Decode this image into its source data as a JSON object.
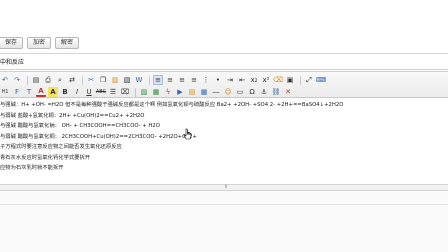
{
  "buttons": {
    "save_label": "保存",
    "encrypt_label": "加密",
    "decrypt_label": "解密"
  },
  "note": {
    "title": "中和反应"
  },
  "toolbar": {
    "row1": [
      {
        "name": "undo-icon",
        "glyph": "↶",
        "color": "blue"
      },
      {
        "name": "redo-icon",
        "glyph": "↷",
        "color": "blue"
      },
      {
        "name": "sep"
      },
      {
        "name": "preview-icon",
        "glyph": "▤"
      },
      {
        "name": "print-icon",
        "glyph": "⎙"
      },
      {
        "name": "search-icon",
        "glyph": "⌕"
      },
      {
        "name": "replace-icon",
        "glyph": "⇄"
      },
      {
        "name": "sep"
      },
      {
        "name": "cut-icon",
        "glyph": "✂",
        "color": "blue"
      },
      {
        "name": "copy-icon",
        "glyph": "❐"
      },
      {
        "name": "paste-icon",
        "glyph": "▥",
        "color": "orange"
      },
      {
        "name": "paste-text-icon",
        "glyph": "▧"
      },
      {
        "name": "paste-word-icon",
        "glyph": "W",
        "color": "blue"
      },
      {
        "name": "sep"
      },
      {
        "name": "align-left-icon",
        "glyph": "≡",
        "active": true
      },
      {
        "name": "align-center-icon",
        "glyph": "≡"
      },
      {
        "name": "align-right-icon",
        "glyph": "≡"
      },
      {
        "name": "align-justify-icon",
        "glyph": "≡"
      },
      {
        "name": "ordered-list-icon",
        "glyph": "⋮"
      },
      {
        "name": "unordered-list-icon",
        "glyph": "•"
      },
      {
        "name": "indent-icon",
        "glyph": "⇥"
      },
      {
        "name": "outdent-icon",
        "glyph": "⇤"
      },
      {
        "name": "subscript-icon",
        "glyph": "x₂"
      },
      {
        "name": "superscript-icon",
        "glyph": "x²"
      },
      {
        "name": "clear-format-icon",
        "glyph": "⌫",
        "color": "orange"
      },
      {
        "name": "select-all-icon",
        "glyph": "▣"
      },
      {
        "name": "sep"
      },
      {
        "name": "fullscreen-icon",
        "glyph": "⤢"
      },
      {
        "name": "source-icon",
        "glyph": "⌨",
        "color": "blue"
      }
    ],
    "row2": [
      {
        "name": "format-block-icon",
        "glyph": "H1",
        "small": true
      },
      {
        "name": "font-family-icon",
        "glyph": "F",
        "color": "blue"
      },
      {
        "name": "font-size-icon",
        "glyph": "T",
        "color": "blue"
      },
      {
        "name": "font-color-icon",
        "glyph": "A",
        "fc": true
      },
      {
        "name": "highlight-icon",
        "glyph": "A",
        "hl": true
      },
      {
        "name": "bold-icon",
        "glyph": "B",
        "bold": true
      },
      {
        "name": "italic-icon",
        "glyph": "I",
        "ital": true
      },
      {
        "name": "underline-icon",
        "glyph": "U",
        "under": true
      },
      {
        "name": "strikethrough-icon",
        "glyph": "ABC",
        "strike": true,
        "small": true
      },
      {
        "name": "line-height-icon",
        "glyph": "☰"
      },
      {
        "name": "remove-format-icon",
        "glyph": "⌧"
      },
      {
        "name": "sep"
      },
      {
        "name": "image-icon",
        "glyph": "▨",
        "color": "green"
      },
      {
        "name": "multi-image-icon",
        "glyph": "▦",
        "color": "green"
      },
      {
        "name": "flash-icon",
        "glyph": "ϟ",
        "color": "red"
      },
      {
        "name": "media-icon",
        "glyph": "▶",
        "color": "blue"
      },
      {
        "name": "insert-file-icon",
        "glyph": "▤",
        "color": "orange"
      },
      {
        "name": "table-icon",
        "glyph": "▦",
        "color": "blue"
      },
      {
        "name": "horizontal-rule-icon",
        "glyph": "―"
      },
      {
        "name": "emoticon-icon",
        "glyph": "☺",
        "color": "orange"
      },
      {
        "name": "page-break-icon",
        "glyph": "▭"
      },
      {
        "name": "special-char-icon",
        "glyph": "Ω"
      },
      {
        "name": "anchor-icon",
        "glyph": "⚓"
      },
      {
        "name": "link-icon",
        "glyph": "⛓",
        "color": "blue"
      },
      {
        "name": "unlink-icon",
        "glyph": "✕",
        "color": "red"
      }
    ]
  },
  "content": {
    "lines": [
      "与强碱：H+ +OH- =H2O 但不是每种强酸于强碱反应都是这个啊 例如氢氧化钡与硫酸反应 Ba2+ +2OH- +SO4 2- +2H+==BaSO4↓+2H2O",
      "与弱碱 盐酸+氢氧化铜：2H+ +Cu(OH)2==Cu2+ +2H2O",
      "与强碱 醋酸与氢氧化钠： OH- + CH3COOH==CH3COO- + H2O",
      "与弱碱 醋酸与氢氧化铜： 2CH3COOH+Cu(OH)2==2CH3COO- +2H2O+Cu2+",
      "子方程式时要注意反应物之间能否发生氧化还原反应",
      "青石灰水反应时氢氧化钙化学式要拆开",
      "应物为石灰乳时就不能拆开"
    ]
  },
  "resize": {
    "grip_glyph": "⇕"
  }
}
